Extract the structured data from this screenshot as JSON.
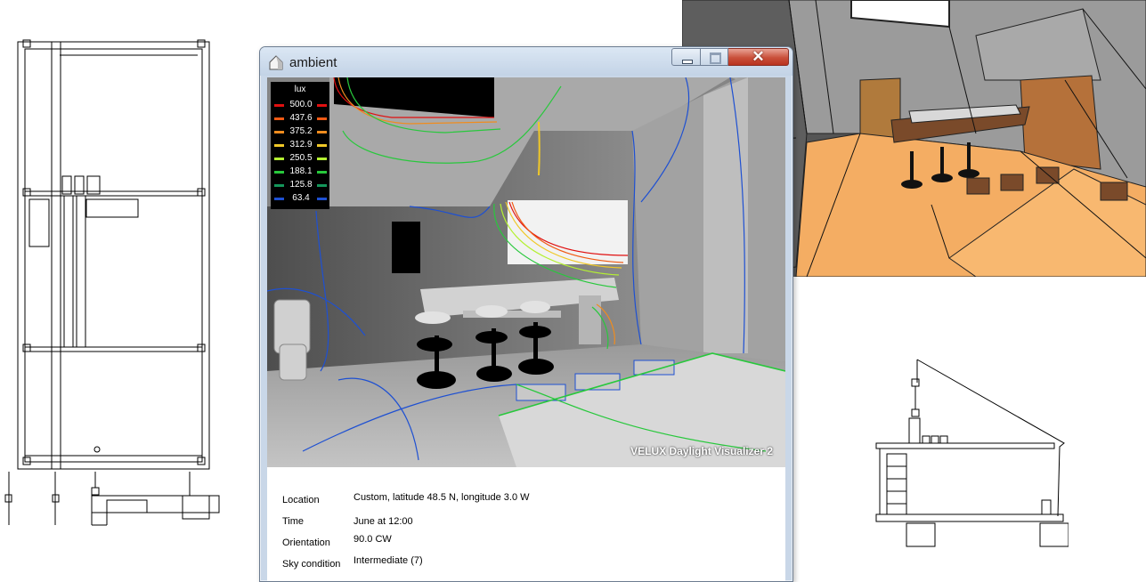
{
  "window": {
    "title": "ambient",
    "close_glyph": "✕"
  },
  "legend": {
    "unit": "lux",
    "entries": [
      {
        "value": "500.0",
        "color": "#e01010"
      },
      {
        "value": "437.6",
        "color": "#f05a14"
      },
      {
        "value": "375.2",
        "color": "#f08c1e"
      },
      {
        "value": "312.9",
        "color": "#f0c828"
      },
      {
        "value": "250.5",
        "color": "#b4f032"
      },
      {
        "value": "188.1",
        "color": "#28c83c"
      },
      {
        "value": "125.8",
        "color": "#14965a"
      },
      {
        "value": "63.4",
        "color": "#1e50d2"
      }
    ]
  },
  "render": {
    "watermark": "VELUX Daylight Visualizer 2"
  },
  "info": {
    "location_label": "Location",
    "location_value": "Custom, latitude 48.5 N, longitude 3.0 W",
    "time_label": "Time",
    "time_value": "June at 12:00",
    "orientation_label": "Orientation",
    "orientation_value": "90.0 CW",
    "sky_label": "Sky condition",
    "sky_value": "Intermediate (7)"
  },
  "colors": {
    "floor": "#f4ad63",
    "window_frame": "#6d7d91",
    "close_button": "#c9503a"
  }
}
